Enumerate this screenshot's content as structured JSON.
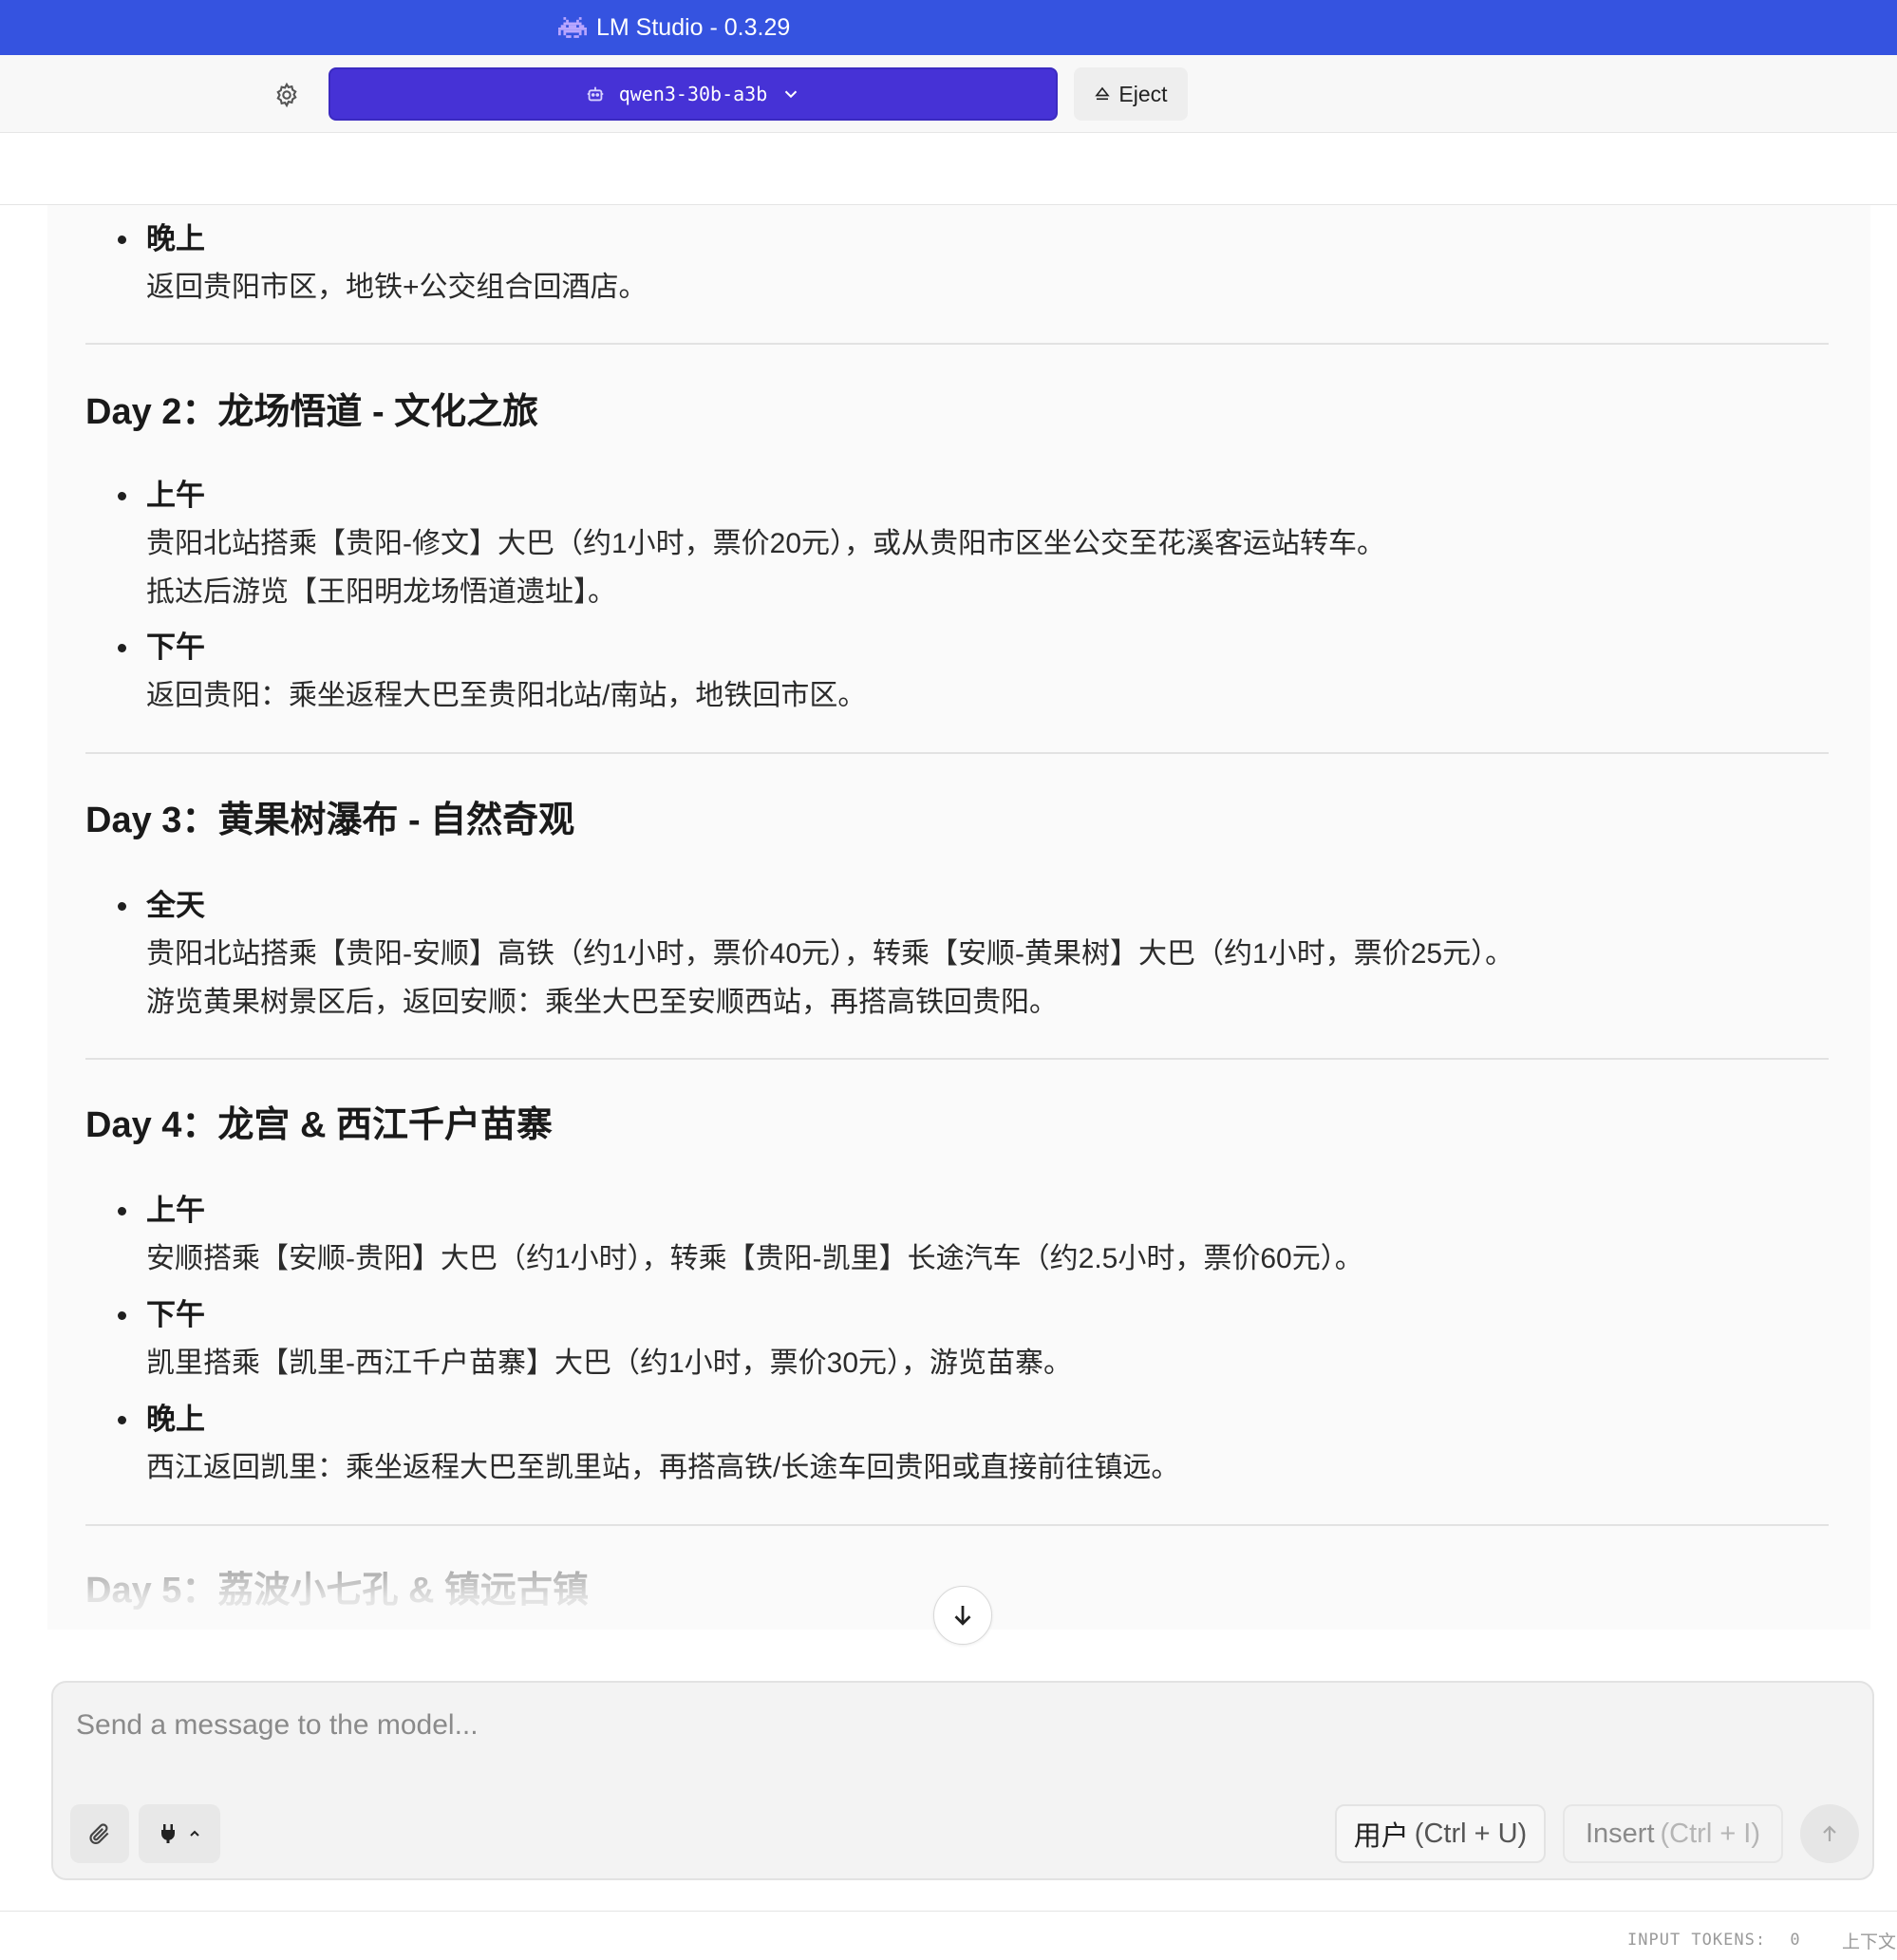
{
  "window": {
    "title": "LM Studio - 0.3.29",
    "icon": "space-invader-icon"
  },
  "toolbar": {
    "settings_icon": "gear-icon",
    "model_name": "qwen3-30b-a3b",
    "model_icon": "robot-icon",
    "eject_label": "Eject",
    "accent": "#4632d6"
  },
  "message": {
    "top_item": {
      "title": "晚上",
      "lines": [
        "返回贵阳市区，地铁+公交组合回酒店。"
      ]
    },
    "days": [
      {
        "heading": "Day 2：龙场悟道 - 文化之旅",
        "items": [
          {
            "title": "上午",
            "lines": [
              "贵阳北站搭乘【贵阳-修文】大巴（约1小时，票价20元），或从贵阳市区坐公交至花溪客运站转车。",
              "抵达后游览【王阳明龙场悟道遗址】。"
            ]
          },
          {
            "title": "下午",
            "lines": [
              "返回贵阳：乘坐返程大巴至贵阳北站/南站，地铁回市区。"
            ]
          }
        ]
      },
      {
        "heading": "Day 3：黄果树瀑布 - 自然奇观",
        "items": [
          {
            "title": "全天",
            "lines": [
              "贵阳北站搭乘【贵阳-安顺】高铁（约1小时，票价40元），转乘【安顺-黄果树】大巴（约1小时，票价25元）。",
              "游览黄果树景区后，返回安顺：乘坐大巴至安顺西站，再搭高铁回贵阳。"
            ]
          }
        ]
      },
      {
        "heading": "Day 4：龙宫 & 西江千户苗寨",
        "items": [
          {
            "title": "上午",
            "lines": [
              "安顺搭乘【安顺-贵阳】大巴（约1小时），转乘【贵阳-凯里】长途汽车（约2.5小时，票价60元）。"
            ]
          },
          {
            "title": "下午",
            "lines": [
              "凯里搭乘【凯里-西江千户苗寨】大巴（约1小时，票价30元），游览苗寨。"
            ]
          },
          {
            "title": "晚上",
            "lines": [
              "西江返回凯里：乘坐返程大巴至凯里站，再搭高铁/长途车回贵阳或直接前往镇远。"
            ]
          }
        ]
      },
      {
        "heading": "Day 5：荔波小七孔 & 镇远古镇",
        "items": []
      }
    ]
  },
  "scroll": {
    "icon": "arrow-down-icon"
  },
  "composer": {
    "placeholder": "Send a message to the model...",
    "value": "",
    "attach_icon": "paperclip-icon",
    "plugin_icon": "plug-icon",
    "role_label": "用户",
    "role_shortcut": "(Ctrl + U)",
    "insert_label": "Insert",
    "insert_shortcut": "(Ctrl + I)",
    "send_icon": "arrow-up-icon"
  },
  "status": {
    "tokens_label": "INPUT TOKENS:",
    "tokens_value": "0",
    "context_label": "上下文"
  }
}
